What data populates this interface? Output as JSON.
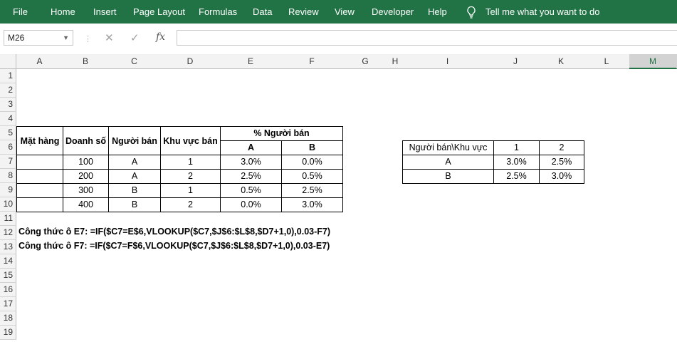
{
  "ribbon": {
    "tabs": [
      "File",
      "Home",
      "Insert",
      "Page Layout",
      "Formulas",
      "Data",
      "Review",
      "View",
      "Developer",
      "Help"
    ],
    "tell_me": "Tell me what you want to do",
    "bg_color": "#217346"
  },
  "formula_bar": {
    "name_box": "M26",
    "cancel_icon": "✕",
    "enter_icon": "✓",
    "fx_label": "fx",
    "content": ""
  },
  "columns": [
    "A",
    "B",
    "C",
    "D",
    "E",
    "F",
    "G",
    "H",
    "I",
    "J",
    "K",
    "L",
    "M"
  ],
  "selected_column": "M",
  "rows": [
    "1",
    "2",
    "3",
    "4",
    "5",
    "6",
    "7",
    "8",
    "9",
    "10",
    "11",
    "12",
    "13",
    "14",
    "15",
    "16",
    "17",
    "18",
    "19"
  ],
  "table1": {
    "headers": {
      "mat_hang": "Mặt hàng",
      "doanh_so": "Doanh số",
      "nguoi_ban": "Người bán",
      "khu_vuc": "Khu vực bán",
      "pct_group": "% Người bán",
      "pct_a": "A",
      "pct_b": "B"
    },
    "rows": [
      {
        "mat_hang": "",
        "doanh_so": "100",
        "nguoi_ban": "A",
        "khu_vuc": "1",
        "pct_a": "3.0%",
        "pct_b": "0.0%"
      },
      {
        "mat_hang": "",
        "doanh_so": "200",
        "nguoi_ban": "A",
        "khu_vuc": "2",
        "pct_a": "2.5%",
        "pct_b": "0.5%"
      },
      {
        "mat_hang": "",
        "doanh_so": "300",
        "nguoi_ban": "B",
        "khu_vuc": "1",
        "pct_a": "0.5%",
        "pct_b": "2.5%"
      },
      {
        "mat_hang": "",
        "doanh_so": "400",
        "nguoi_ban": "B",
        "khu_vuc": "2",
        "pct_a": "0.0%",
        "pct_b": "3.0%"
      }
    ]
  },
  "table2": {
    "header": [
      "Người bán\\Khu vực",
      "1",
      "2"
    ],
    "rows": [
      [
        "A",
        "3.0%",
        "2.5%"
      ],
      [
        "B",
        "2.5%",
        "3.0%"
      ]
    ]
  },
  "formulas": {
    "row12": "Công thức ô E7: =IF($C7=E$6,VLOOKUP($C7,$J$6:$L$8,$D7+1,0),0.03-F7)",
    "row13": "Công thức ô F7: =IF($C7=F$6,VLOOKUP($C7,$J$6:$L$8,$D7+1,0),0.03-E7)"
  }
}
